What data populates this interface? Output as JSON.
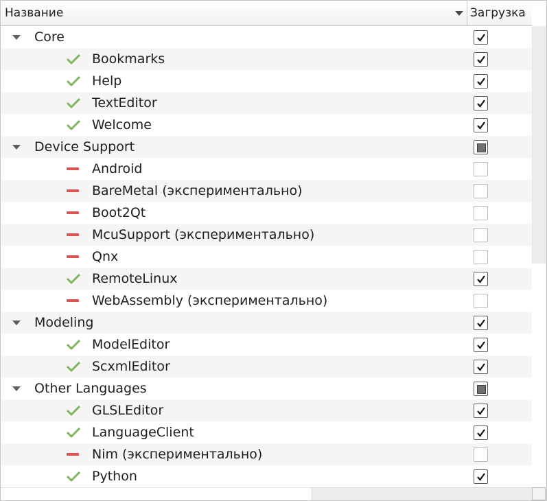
{
  "header": {
    "name_label": "Название",
    "load_label": "Загрузка"
  },
  "rows": [
    {
      "level": "group",
      "label": "Core",
      "status": null,
      "check": "checked"
    },
    {
      "level": "child",
      "label": "Bookmarks",
      "status": "ok",
      "check": "checked"
    },
    {
      "level": "child",
      "label": "Help",
      "status": "ok",
      "check": "checked"
    },
    {
      "level": "child",
      "label": "TextEditor",
      "status": "ok",
      "check": "checked"
    },
    {
      "level": "child",
      "label": "Welcome",
      "status": "ok",
      "check": "checked"
    },
    {
      "level": "group",
      "label": "Device Support",
      "status": null,
      "check": "partial"
    },
    {
      "level": "child",
      "label": "Android",
      "status": "disabled",
      "check": "unchecked"
    },
    {
      "level": "child",
      "label": "BareMetal (экспериментально)",
      "status": "disabled",
      "check": "unchecked"
    },
    {
      "level": "child",
      "label": "Boot2Qt",
      "status": "disabled",
      "check": "unchecked"
    },
    {
      "level": "child",
      "label": "McuSupport (экспериментально)",
      "status": "disabled",
      "check": "unchecked"
    },
    {
      "level": "child",
      "label": "Qnx",
      "status": "disabled",
      "check": "unchecked"
    },
    {
      "level": "child",
      "label": "RemoteLinux",
      "status": "ok",
      "check": "checked"
    },
    {
      "level": "child",
      "label": "WebAssembly (экспериментально)",
      "status": "disabled",
      "check": "unchecked"
    },
    {
      "level": "group",
      "label": "Modeling",
      "status": null,
      "check": "checked"
    },
    {
      "level": "child",
      "label": "ModelEditor",
      "status": "ok",
      "check": "checked"
    },
    {
      "level": "child",
      "label": "ScxmlEditor",
      "status": "ok",
      "check": "checked"
    },
    {
      "level": "group",
      "label": "Other Languages",
      "status": null,
      "check": "partial"
    },
    {
      "level": "child",
      "label": "GLSLEditor",
      "status": "ok",
      "check": "checked"
    },
    {
      "level": "child",
      "label": "LanguageClient",
      "status": "ok",
      "check": "checked"
    },
    {
      "level": "child",
      "label": "Nim (экспериментально)",
      "status": "disabled",
      "check": "unchecked"
    },
    {
      "level": "child",
      "label": "Python",
      "status": "ok",
      "check": "checked"
    }
  ],
  "icons": {
    "expander": "chevron-down-icon",
    "ok": "check-icon",
    "disabled": "minus-icon"
  },
  "colors": {
    "ok": "#7cb65b",
    "disabled": "#d9534f",
    "alt_row": "#f5f5f5"
  }
}
